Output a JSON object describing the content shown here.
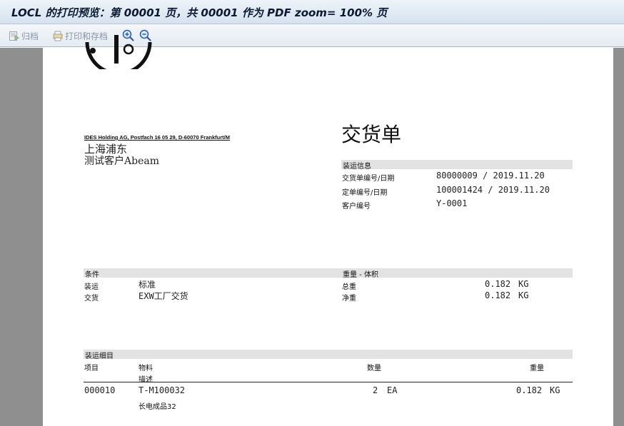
{
  "window": {
    "title": "LOCL 的打印预览：第 00001 页，共 00001 作为 PDF zoom= 100% 页"
  },
  "toolbar": {
    "archive_label": "归档",
    "print_archive_label": "打印和存档",
    "zoom_in_icon": "zoom-in-icon",
    "zoom_out_icon": "zoom-out-icon"
  },
  "document": {
    "sender_line": "IDES Holding AG, Postfach 16 05 29, D-60070 Frankfurt/M",
    "recipient": [
      "上海浦东",
      "测试客户Abeam"
    ],
    "doc_title": "交货单",
    "shipping_info": {
      "header": "装运信息",
      "rows": [
        {
          "label": "交货单编号/日期",
          "value": "80000009 / 2019.11.20"
        },
        {
          "label": "定单编号/日期",
          "value": "100001424 / 2019.11.20"
        },
        {
          "label": "客户编号",
          "value": "Y-0001"
        }
      ]
    },
    "conditions": {
      "header": "条件",
      "rows": [
        {
          "label": "装运",
          "value": "标准"
        },
        {
          "label": "交货",
          "value": "EXW工厂交货"
        }
      ]
    },
    "weight_volume": {
      "header": "重量 - 体积",
      "rows": [
        {
          "label": "总重",
          "value": "0.182",
          "unit": "KG"
        },
        {
          "label": "净重",
          "value": "0.182",
          "unit": "KG"
        }
      ]
    },
    "items": {
      "header": "装运细目",
      "columns": {
        "item": "项目",
        "material": "物料",
        "description": "描述",
        "quantity": "数量",
        "weight": "重量"
      },
      "rows": [
        {
          "item": "000010",
          "material": "T-M100032",
          "description": "长电成品32",
          "quantity": "2",
          "qty_unit": "EA",
          "weight": "0.182",
          "weight_unit": "KG"
        }
      ]
    }
  }
}
